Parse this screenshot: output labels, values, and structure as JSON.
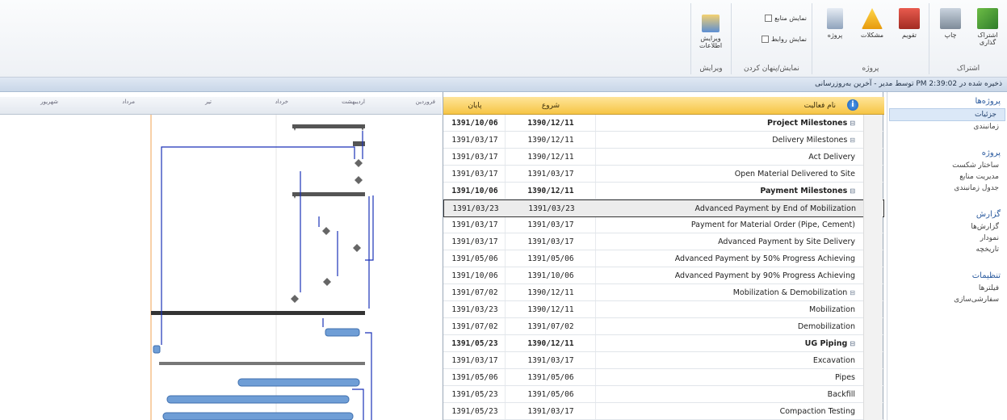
{
  "ribbon": {
    "groups": [
      {
        "label": "اشتراک"
      },
      {
        "label": "پروژه"
      },
      {
        "label": "نمایش/پنهان کردن"
      },
      {
        "label": "ویرایش"
      }
    ],
    "buttons": {
      "share_label": "اشتراک گذاری",
      "print_label": "چاپ",
      "calendar_label": "تقویم",
      "issues_label": "مشکلات",
      "project_label": "پروژه",
      "edit_label": "ویرایش اطلاعات"
    },
    "checks": {
      "show_resources": "نمایش منابع",
      "show_links": "نمایش روابط"
    }
  },
  "statusbar": {
    "text": "ذخیره شده در 2:39:02 PM توسط مدیر - آخرین به‌روزرسانی"
  },
  "nav": {
    "sections": [
      {
        "head": "پروژه‌ها",
        "items": [
          {
            "label": "جزئیات",
            "active": true
          },
          {
            "label": "زمانبندی",
            "active": false
          }
        ]
      },
      {
        "head": "پروژه",
        "items": [
          {
            "label": "ساختار شکست"
          },
          {
            "label": "مدیریت منابع"
          },
          {
            "label": "جدول زمانبندی"
          }
        ]
      },
      {
        "head": "گزارش",
        "items": [
          {
            "label": "گزارش‌ها"
          },
          {
            "label": "نمودار"
          },
          {
            "label": "تاریخچه"
          }
        ]
      },
      {
        "head": "تنظیمات",
        "items": [
          {
            "label": "فیلترها"
          },
          {
            "label": "سفارشی‌سازی"
          }
        ]
      }
    ]
  },
  "grid": {
    "headers": {
      "finish": "پایان",
      "start": "شروع",
      "name": "نام فعالیت"
    },
    "rows": [
      {
        "d1": "1391/10/06",
        "d2": "1390/12/11",
        "name": "Project Milestones",
        "bold": true,
        "expand": "⊟"
      },
      {
        "d1": "1391/03/17",
        "d2": "1390/12/11",
        "name": "Delivery Milestones",
        "bold": false,
        "expand": "⊟"
      },
      {
        "d1": "1391/03/17",
        "d2": "1390/12/11",
        "name": "Act Delivery",
        "bold": false,
        "expand": ""
      },
      {
        "d1": "1391/03/17",
        "d2": "1391/03/17",
        "name": "Open Material Delivered to Site",
        "bold": false,
        "expand": ""
      },
      {
        "d1": "1391/10/06",
        "d2": "1390/12/11",
        "name": "Payment Milestones",
        "bold": true,
        "expand": "⊟"
      },
      {
        "d1": "1391/03/23",
        "d2": "1391/03/23",
        "name": "Advanced Payment by End of Mobilization",
        "bold": false,
        "expand": "",
        "sel": true
      },
      {
        "d1": "1391/03/17",
        "d2": "1391/03/17",
        "name": "Payment for Material Order (Pipe, Cement)",
        "bold": false,
        "expand": ""
      },
      {
        "d1": "1391/03/17",
        "d2": "1391/03/17",
        "name": "Advanced Payment by Site Delivery",
        "bold": false,
        "expand": ""
      },
      {
        "d1": "1391/05/06",
        "d2": "1391/05/06",
        "name": "Advanced Payment by 50% Progress Achieving",
        "bold": false,
        "expand": ""
      },
      {
        "d1": "1391/10/06",
        "d2": "1391/10/06",
        "name": "Advanced Payment by 90% Progress Achieving",
        "bold": false,
        "expand": ""
      },
      {
        "d1": "1391/07/02",
        "d2": "1390/12/11",
        "name": "Mobilization & Demobilization",
        "bold": false,
        "expand": "⊟"
      },
      {
        "d1": "1391/03/23",
        "d2": "1390/12/11",
        "name": "Mobilization",
        "bold": false,
        "expand": ""
      },
      {
        "d1": "1391/07/02",
        "d2": "1391/07/02",
        "name": "Demobilization",
        "bold": false,
        "expand": ""
      },
      {
        "d1": "1391/05/23",
        "d2": "1390/12/11",
        "name": "UG Piping",
        "bold": true,
        "expand": "⊟"
      },
      {
        "d1": "1391/03/17",
        "d2": "1391/03/17",
        "name": "Excavation",
        "bold": false,
        "expand": ""
      },
      {
        "d1": "1391/05/06",
        "d2": "1391/05/06",
        "name": "Pipes",
        "bold": false,
        "expand": ""
      },
      {
        "d1": "1391/05/23",
        "d2": "1391/05/06",
        "name": "Backfill",
        "bold": false,
        "expand": ""
      },
      {
        "d1": "1391/05/23",
        "d2": "1391/03/17",
        "name": "Compaction Testing",
        "bold": false,
        "expand": ""
      }
    ]
  },
  "gantt": {
    "months": [
      "فروردین",
      "اردیبهشت",
      "خرداد",
      "تیر",
      "مرداد",
      "شهریور"
    ],
    "colors": {
      "bar": "#6f9ed6",
      "summary": "#555555",
      "link": "#1a32b8",
      "today": "#f0a050"
    }
  }
}
